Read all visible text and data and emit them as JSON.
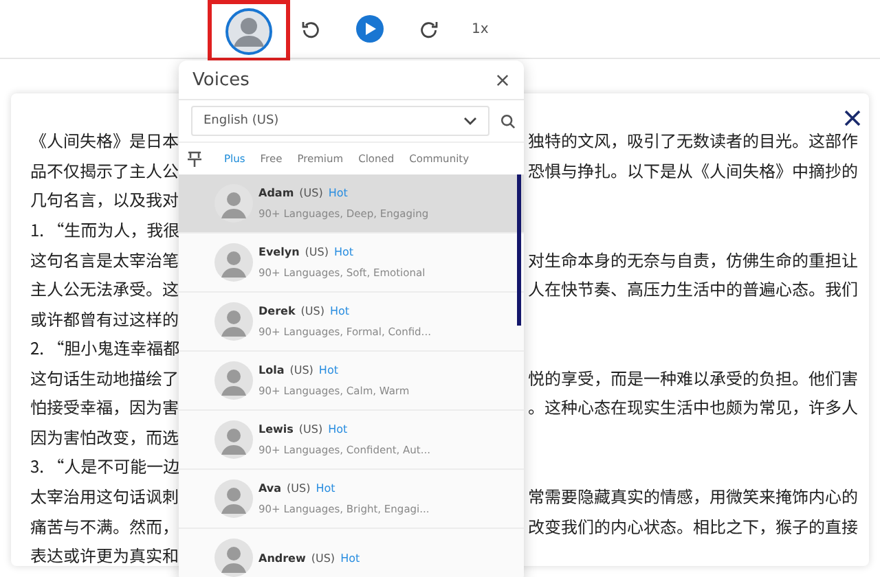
{
  "toolbar": {
    "speed": "1x",
    "voice_highlighted": true
  },
  "article": {
    "lines": [
      {
        "left": "《人间失格》是日本",
        "right": "独特的文风，吸引了无数读者的目光。这部作"
      },
      {
        "left": "品不仅揭示了主人公",
        "right": "恐惧与挣扎。以下是从《人间失格》中摘抄的"
      },
      {
        "left": "几句名言，以及我对"
      },
      {
        "left": "1. “生而为人，我很"
      },
      {
        "left": "这句名言是太宰治笔",
        "right": "对生命本身的无奈与自责，仿佛生命的重担让"
      },
      {
        "left": "主人公无法承受。这",
        "right": "人在快节奏、高压力生活中的普遍心态。我们"
      },
      {
        "left": "或许都曾有过这样的"
      },
      {
        "left": "2. “胆小鬼连幸福都"
      },
      {
        "left": "这句话生动地描绘了",
        "right": "悦的享受，而是一种难以承受的负担。他们害"
      },
      {
        "left": "怕接受幸福，因为害",
        "right": "。这种心态在现实生活中也颇为常见，许多人"
      },
      {
        "left": "因为害怕改变，而选"
      },
      {
        "left": "3. “人是不可能一边"
      },
      {
        "left": "太宰治用这句话讽刺",
        "right": "常需要隐藏真实的情感，用微笑来掩饰内心的"
      },
      {
        "left": "痛苦与不满。然而，",
        "right": "改变我们的内心状态。相比之下，猴子的直接"
      },
      {
        "left": "表达或许更为真实和"
      }
    ]
  },
  "voices_panel": {
    "title": "Voices",
    "language": "English (US)",
    "tabs": [
      {
        "label": "Plus",
        "selected": true
      },
      {
        "label": "Free",
        "selected": false
      },
      {
        "label": "Premium",
        "selected": false
      },
      {
        "label": "Cloned",
        "selected": false
      },
      {
        "label": "Community",
        "selected": false
      }
    ],
    "voices": [
      {
        "name": "Adam",
        "region": "(US)",
        "badge": "Hot",
        "description": "90+ Languages, Deep, Engaging",
        "selected": true
      },
      {
        "name": "Evelyn",
        "region": "(US)",
        "badge": "Hot",
        "description": "90+ Languages, Soft, Emotional",
        "selected": false
      },
      {
        "name": "Derek",
        "region": "(US)",
        "badge": "Hot",
        "description": "90+ Languages, Formal, Confid...",
        "selected": false
      },
      {
        "name": "Lola",
        "region": "(US)",
        "badge": "Hot",
        "description": "90+ Languages, Calm, Warm",
        "selected": false
      },
      {
        "name": "Lewis",
        "region": "(US)",
        "badge": "Hot",
        "description": "90+ Languages, Confident, Aut...",
        "selected": false
      },
      {
        "name": "Ava",
        "region": "(US)",
        "badge": "Hot",
        "description": "90+ Languages, Bright, Engagi...",
        "selected": false
      },
      {
        "name": "Andrew",
        "region": "(US)",
        "badge": "Hot",
        "selected": false
      }
    ]
  }
}
